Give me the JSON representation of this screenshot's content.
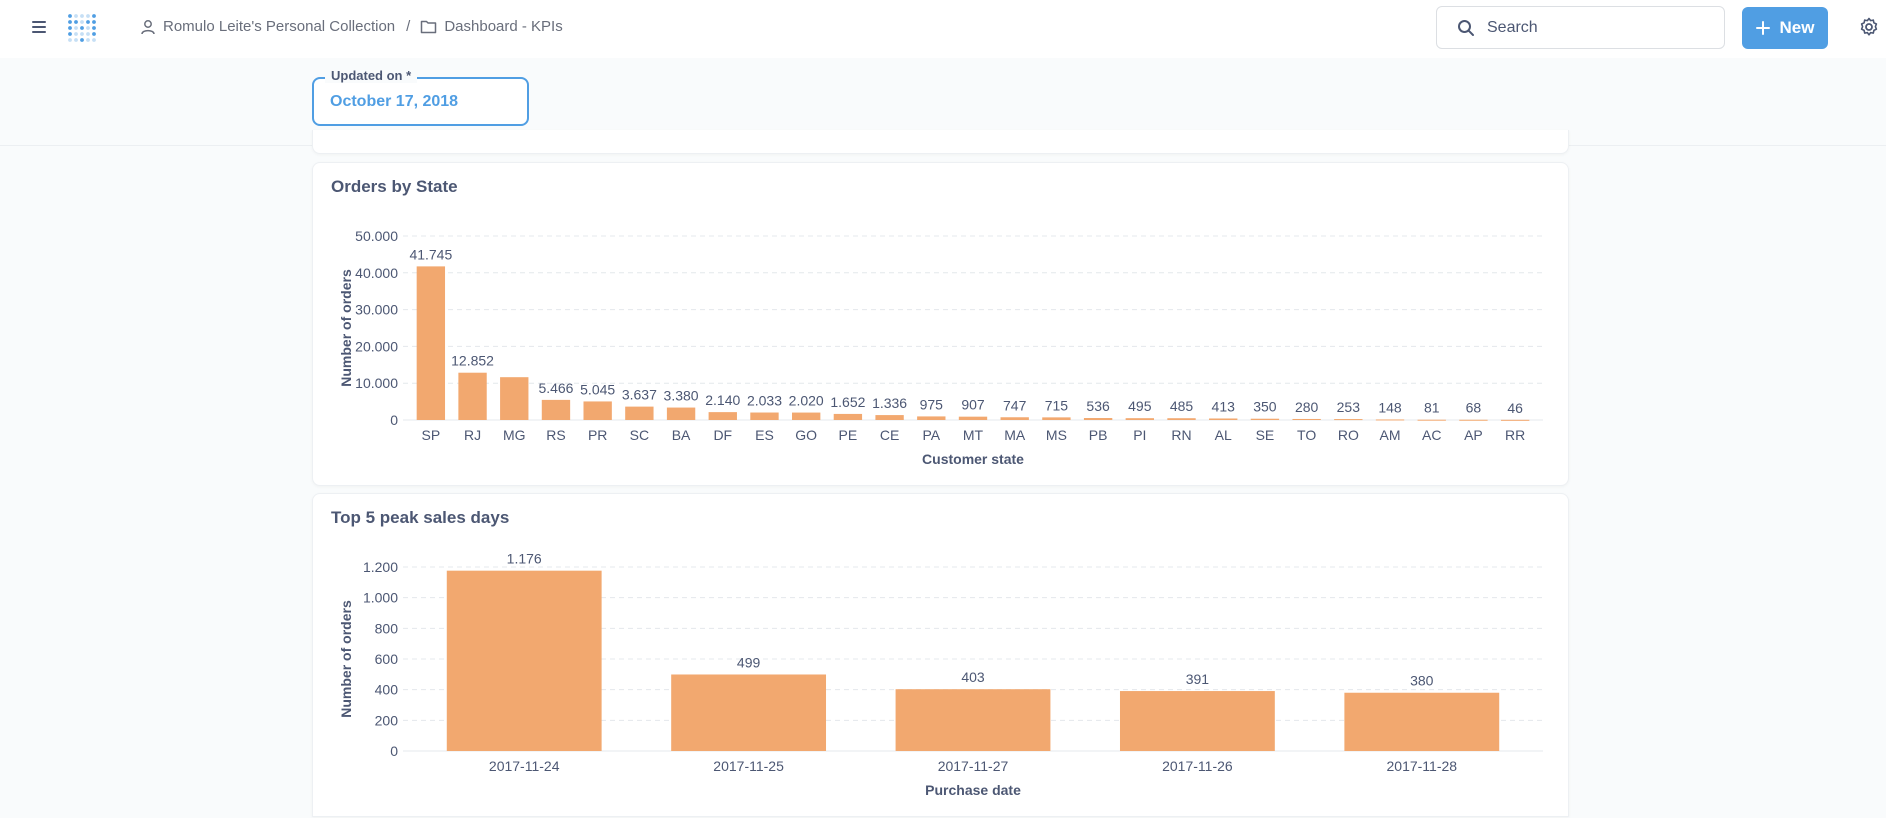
{
  "header": {
    "breadcrumb": {
      "collection": "Romulo Leite's Personal Collection",
      "separator": "/",
      "dashboard": "Dashboard - KPIs"
    },
    "search_label": "Search",
    "new_label": "New"
  },
  "filters": {
    "date_label": "Updated on *",
    "date_value": "October 17, 2018"
  },
  "colors": {
    "accent": "#509ee3",
    "bar": "#f2a86f"
  },
  "cards": [
    {
      "title": "Orders by State"
    },
    {
      "title": "Top 5 peak sales days"
    }
  ],
  "chart_data": [
    {
      "type": "bar",
      "title": "Orders by State",
      "xlabel": "Customer state",
      "ylabel": "Number of orders",
      "ylim": [
        0,
        50000
      ],
      "yticks": [
        {
          "value": 0,
          "label": "0"
        },
        {
          "value": 10000,
          "label": "10.000"
        },
        {
          "value": 20000,
          "label": "20.000"
        },
        {
          "value": 30000,
          "label": "30.000"
        },
        {
          "value": 40000,
          "label": "40.000"
        },
        {
          "value": 50000,
          "label": "50.000"
        }
      ],
      "categories": [
        "SP",
        "RJ",
        "MG",
        "RS",
        "PR",
        "SC",
        "BA",
        "DF",
        "ES",
        "GO",
        "PE",
        "CE",
        "PA",
        "MT",
        "MA",
        "MS",
        "PB",
        "PI",
        "RN",
        "AL",
        "SE",
        "TO",
        "RO",
        "AM",
        "AC",
        "AP",
        "RR"
      ],
      "values": [
        41745,
        12852,
        11635,
        5466,
        5045,
        3637,
        3380,
        2140,
        2033,
        2020,
        1652,
        1336,
        975,
        907,
        747,
        715,
        536,
        495,
        485,
        413,
        350,
        280,
        253,
        148,
        81,
        68,
        46
      ],
      "data_labels": [
        "41.745",
        "12.852",
        "",
        "5.466",
        "5.045",
        "3.637",
        "3.380",
        "2.140",
        "2.033",
        "2.020",
        "1.652",
        "1.336",
        "975",
        "907",
        "747",
        "715",
        "536",
        "495",
        "485",
        "413",
        "350",
        "280",
        "253",
        "148",
        "81",
        "68",
        "46"
      ],
      "grid": true,
      "legend": "none"
    },
    {
      "type": "bar",
      "title": "Top 5 peak sales days",
      "xlabel": "Purchase date",
      "ylabel": "Number of orders",
      "ylim": [
        0,
        1200
      ],
      "yticks": [
        {
          "value": 0,
          "label": "0"
        },
        {
          "value": 200,
          "label": "200"
        },
        {
          "value": 400,
          "label": "400"
        },
        {
          "value": 600,
          "label": "600"
        },
        {
          "value": 800,
          "label": "800"
        },
        {
          "value": 1000,
          "label": "1.000"
        },
        {
          "value": 1200,
          "label": "1.200"
        }
      ],
      "categories": [
        "2017-11-24",
        "2017-11-25",
        "2017-11-27",
        "2017-11-26",
        "2017-11-28"
      ],
      "values": [
        1176,
        499,
        403,
        391,
        380
      ],
      "data_labels": [
        "1.176",
        "499",
        "403",
        "391",
        "380"
      ],
      "grid": true,
      "legend": "none"
    }
  ]
}
